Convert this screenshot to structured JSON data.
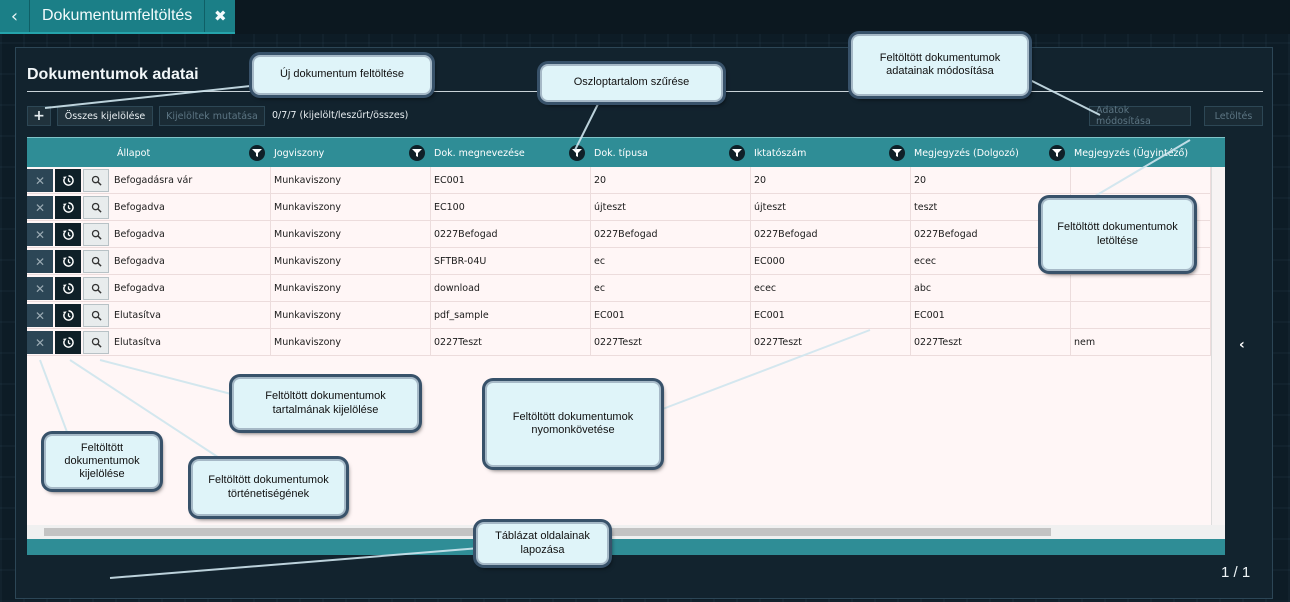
{
  "tab": {
    "back_icon": "‹",
    "title": "Dokumentumfeltöltés",
    "close_icon": "✖"
  },
  "section": {
    "title": "Dokumentumok adatai"
  },
  "toolbar": {
    "add_label": "+",
    "select_all": "Összes kijelölése",
    "show_selected": "Kijelöltek mutatása",
    "count": "0/7/7 (kijelölt/leszűrt/összes)",
    "modify": "Adatok módosítása",
    "download": "Letöltés"
  },
  "columns": [
    "Állapot",
    "Jogviszony",
    "Dok. megnevezése",
    "Dok. típusa",
    "Iktatószám",
    "Megjegyzés (Dolgozó)",
    "Megjegyzés (Ügyintéző)"
  ],
  "rows": [
    [
      "Befogadásra vár",
      "Munkaviszony",
      "EC001",
      "20",
      "20",
      "20",
      ""
    ],
    [
      "Befogadva",
      "Munkaviszony",
      "EC100",
      "újteszt",
      "újteszt",
      "teszt",
      ""
    ],
    [
      "Befogadva",
      "Munkaviszony",
      "0227Befogad",
      "0227Befogad",
      "0227Befogad",
      "0227Befogad",
      ""
    ],
    [
      "Befogadva",
      "Munkaviszony",
      "SFTBR-04U",
      "ec",
      "EC000",
      "ecec",
      ""
    ],
    [
      "Befogadva",
      "Munkaviszony",
      "download",
      "ec",
      "ecec",
      "abc",
      ""
    ],
    [
      "Elutasítva",
      "Munkaviszony",
      "pdf_sample",
      "EC001",
      "EC001",
      "EC001",
      ""
    ],
    [
      "Elutasítva",
      "Munkaviszony",
      "0227Teszt",
      "0227Teszt",
      "0227Teszt",
      "0227Teszt",
      "nem"
    ]
  ],
  "pager": {
    "first": "⏮",
    "prev": "‹",
    "current": "1",
    "next": "›",
    "last": "⏭",
    "info": "1 / 1"
  },
  "side_toggle": "‹",
  "callouts": {
    "new_upload": "Új dokumentum feltöltése",
    "column_filter": "Oszloptartalom szűrése",
    "modify_data": "Feltöltött dokumentumok adatainak módosítása",
    "download_docs": "Feltöltött dokumentumok letöltése",
    "select_content": "Feltöltött dokumentumok tartalmának kijelölése",
    "tracking": "Feltöltött dokumentumok nyomonkövetése",
    "select_docs": "Feltöltött dokumentumok kijelölése",
    "history": "Feltöltött dokumentumok történetiségének",
    "paging": "Táblázat oldalainak lapozása"
  },
  "colors": {
    "accent": "#2f8d96",
    "background": "#12232e",
    "grid_bg": "#fff6f6"
  }
}
